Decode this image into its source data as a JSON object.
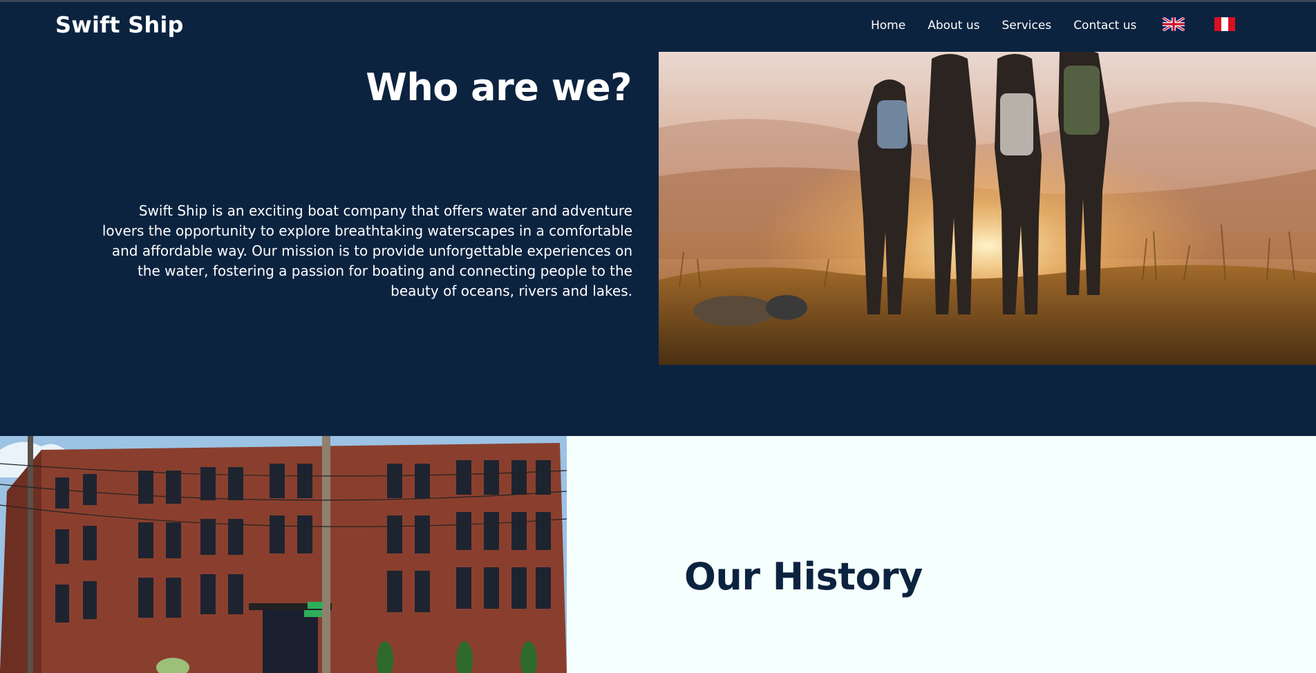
{
  "brand": {
    "name": "Swift Ship"
  },
  "nav": {
    "items": [
      {
        "label": "Home"
      },
      {
        "label": "About us"
      },
      {
        "label": "Services"
      },
      {
        "label": "Contact us"
      }
    ],
    "languages": [
      {
        "icon": "uk-flag-icon"
      },
      {
        "icon": "peru-flag-icon"
      }
    ]
  },
  "hero": {
    "title": "Who are we?",
    "description": "Swift Ship is an exciting boat company that offers water and adventure lovers the opportunity to explore breathtaking waterscapes in a comfortable and affordable way. Our mission is to provide unforgettable experiences on the water, fostering a passion for boating and connecting people to the beauty of oceans, rivers and lakes."
  },
  "history": {
    "title": "Our History"
  },
  "colors": {
    "navy": "#0c2340",
    "light": "#f5fffd",
    "white": "#ffffff"
  }
}
